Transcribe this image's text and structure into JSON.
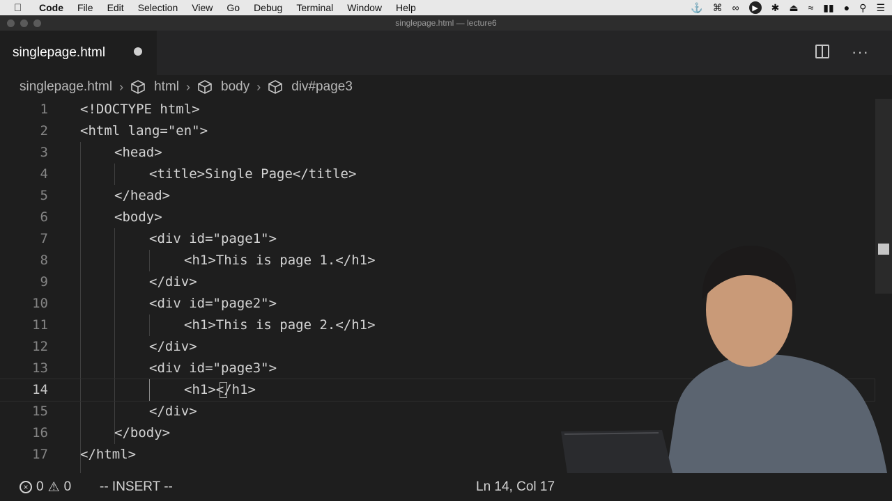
{
  "menubar": {
    "app": "Code",
    "items": [
      "File",
      "Edit",
      "Selection",
      "View",
      "Go",
      "Debug",
      "Terminal",
      "Window",
      "Help"
    ]
  },
  "window": {
    "title": "singlepage.html — lecture6"
  },
  "tab": {
    "label": "singlepage.html"
  },
  "breadcrumb": [
    "singlepage.html",
    "html",
    "body",
    "div#page3"
  ],
  "editor": {
    "lines": [
      {
        "n": "1"
      },
      {
        "n": "2"
      },
      {
        "n": "3"
      },
      {
        "n": "4"
      },
      {
        "n": "5"
      },
      {
        "n": "6"
      },
      {
        "n": "7"
      },
      {
        "n": "8"
      },
      {
        "n": "9"
      },
      {
        "n": "10"
      },
      {
        "n": "11"
      },
      {
        "n": "12"
      },
      {
        "n": "13"
      },
      {
        "n": "14"
      },
      {
        "n": "15"
      },
      {
        "n": "16"
      },
      {
        "n": "17"
      }
    ],
    "code": [
      "<!DOCTYPE html>",
      "<html lang=\"en\">",
      "<head>",
      "<title>Single Page</title>",
      "</head>",
      "<body>",
      "<div id=\"page1\">",
      "<h1>This is page 1.</h1>",
      "</div>",
      "<div id=\"page2\">",
      "<h1>This is page 2.</h1>",
      "</div>",
      "<div id=\"page3\">",
      "<h1></h1>",
      "</div>",
      "</body>",
      "</html>"
    ]
  },
  "status": {
    "errors": "0",
    "warnings": "0",
    "mode": "-- INSERT --",
    "position": "Ln 14, Col 17"
  },
  "colors": {
    "background": "#1e1e1e",
    "menubar": "#e8e8e8",
    "tabbar": "#252526",
    "text": "#d4d4d4",
    "line_number": "#858585"
  }
}
